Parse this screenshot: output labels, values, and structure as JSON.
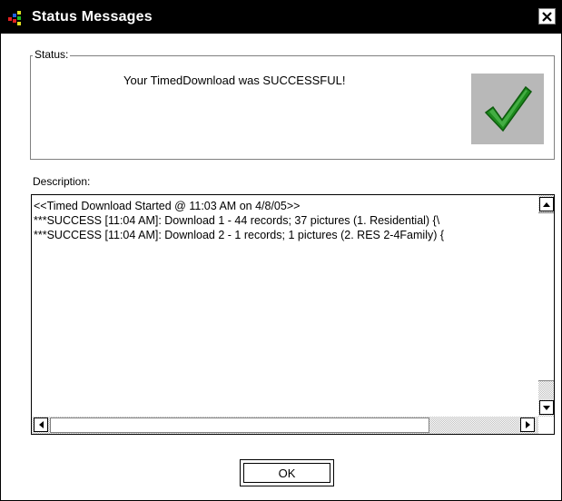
{
  "window": {
    "title": "Status Messages",
    "close_label": "Close",
    "app_icon": "stacked-bars-icon",
    "colors": {
      "titlebar": "#000000",
      "check": "#1d8a1d"
    }
  },
  "status_group": {
    "legend": "Status:",
    "message": "Your TimedDownload was SUCCESSFUL!",
    "icon": "green-checkmark-icon"
  },
  "description": {
    "label": "Description:",
    "lines": [
      "<<Timed Download Started @ 11:03 AM on 4/8/05>>",
      "***SUCCESS [11:04 AM]: Download 1 - 44 records; 37 pictures (1. Residential) {\\",
      "***SUCCESS [11:04 AM]: Download 2 - 1 records; 1 pictures (2. RES 2-4Family) {"
    ]
  },
  "buttons": {
    "ok": "OK"
  }
}
